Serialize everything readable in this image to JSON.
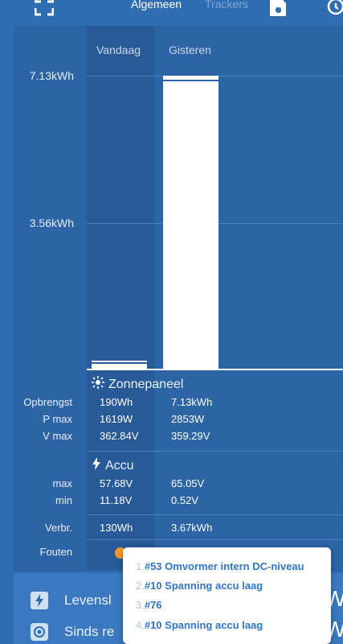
{
  "topbar": {
    "tabs": [
      {
        "label": "Algemeen",
        "active": true
      },
      {
        "label": "Trackers",
        "active": false
      }
    ],
    "icons": [
      "fullscreen-icon",
      "save-icon",
      "history-icon"
    ]
  },
  "chart": {
    "columns": [
      "Vandaag",
      "Gisteren"
    ],
    "y_ticks": [
      "7.13kWh",
      "3.56kWh"
    ]
  },
  "chart_data": {
    "type": "bar",
    "categories": [
      "Vandaag",
      "Gisteren"
    ],
    "values_kwh": [
      0.19,
      7.13
    ],
    "ylim": [
      0,
      7.13
    ],
    "y_tick_labels": [
      "3.56kWh",
      "7.13kWh"
    ]
  },
  "solar": {
    "title": "Zonnepaneel",
    "rows": [
      {
        "label": "Opbrengst",
        "today": "190Wh",
        "yesterday": "7.13kWh"
      },
      {
        "label": "P max",
        "today": "1619W",
        "yesterday": "2853W"
      },
      {
        "label": "V max",
        "today": "362.84V",
        "yesterday": "359.29V"
      }
    ]
  },
  "battery": {
    "title": "Accu",
    "rows": [
      {
        "label": "max",
        "today": "57.68V",
        "yesterday": "65.05V"
      },
      {
        "label": "min",
        "today": "11.18V",
        "yesterday": "0.52V"
      }
    ]
  },
  "consumption": {
    "label": "Verbr.",
    "today": "130Wh",
    "yesterday": "3.67kWh"
  },
  "errors": {
    "label": "Fouten"
  },
  "bottom": {
    "rows": [
      {
        "label": "Levensl",
        "icon": "lightning-icon"
      },
      {
        "label": "Sinds re",
        "icon": "target-icon"
      }
    ],
    "cut_text": "Wh"
  },
  "popup": {
    "items": [
      {
        "num": "1.",
        "text": "#53 Omvormer intern DC-niveau"
      },
      {
        "num": "2.",
        "text": "#10 Spanning accu laag"
      },
      {
        "num": "3.",
        "text": "#76"
      },
      {
        "num": "4.",
        "text": "#10 Spanning accu laag"
      }
    ]
  }
}
